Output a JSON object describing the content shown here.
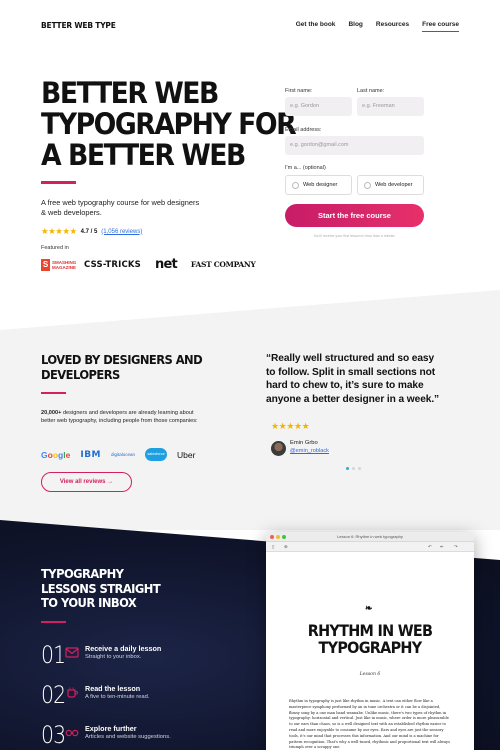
{
  "header": {
    "logo": "BETTER WEB TYPE",
    "nav": [
      "Get the book",
      "Blog",
      "Resources",
      "Free course"
    ],
    "nav_active_index": 3
  },
  "hero": {
    "title_lines": [
      "BETTER WEB",
      "TYPOGRAPHY FOR",
      "A BETTER WEB"
    ],
    "subtitle": "A free web typography course for web designers & web developers.",
    "stars": "★★★★★",
    "rating": "4.7 / 5",
    "rating_count": "(1,056 reviews)",
    "featured_label": "Featured in",
    "press": {
      "smashing": "SMASHING MAGAZINE",
      "css_tricks": "CSS-TRICKS",
      "net": "net",
      "fast_company": "FAST COMPANY"
    }
  },
  "signup": {
    "first_name_label": "First name:",
    "first_name_placeholder": "e.g. Gordon",
    "last_name_label": "Last name:",
    "last_name_placeholder": "e.g. Freeman",
    "email_label": "Email address:",
    "email_placeholder": "e.g. gordon@gmail.com",
    "role_label": "I'm a... (optional)",
    "role_options": [
      "Web designer",
      "Web developer"
    ],
    "submit_label": "Start the free course",
    "fine_print": "You'll receive your first lesson in less than a minute."
  },
  "social_proof": {
    "title_lines": [
      "LOVED BY DESIGNERS AND",
      "DEVELOPERS"
    ],
    "text_strong": "20,000+",
    "text": " designers and developers are already learning about better web typography, including people from those companies:",
    "brands": [
      "Google",
      "IBM",
      "digitalocean",
      "salesforce",
      "Uber"
    ],
    "button_label": "View all reviews →"
  },
  "testimonial": {
    "quote": "“Really well structured and so easy to follow. Split in small sections not hard to chew to, it’s sure to make anyone a better designer in a week.”",
    "stars": "★★★★★",
    "author": "Emin Grbo",
    "handle": "@emin_roblack",
    "slides_total": 3,
    "active_slide": 1
  },
  "lessons": {
    "title_lines": [
      "TYPOGRAPHY",
      "LESSONS STRAIGHT",
      "TO YOUR INBOX"
    ],
    "steps": [
      {
        "num": "01",
        "icon": "envelope-icon",
        "title": "Receive a daily lesson",
        "sub": "Straight to your inbox."
      },
      {
        "num": "02",
        "icon": "coffee-cup-icon",
        "title": "Read the lesson",
        "sub": "A five to ten-minute read."
      },
      {
        "num": "03",
        "icon": "glasses-icon",
        "title": "Explore further",
        "sub": "Articles and website suggestions."
      }
    ]
  },
  "book_window": {
    "window_title": "Lesson 6: Rhythm in web typography",
    "mark": "❧",
    "title_lines": [
      "RHYTHM IN WEB",
      "TYPOGRAPHY"
    ],
    "lesson": "Lesson 6",
    "body": "Rhythm in typography is just like rhythm in music. A text can either flow like a masterpiece symphony performed by an in tune orchestra or it can be a disjointed, flimsy song by a one man band wannabe. Unlike music, there's two types of rhythm in typography: horizontal and vertical. Just like in music, where order is more pleasurable to our ears than chaos, so is a well designed text with an established rhythm easier to read and more enjoyable to consume by our eyes. Ears and eyes are just the sensory tools, it's our mind that processes this information. And our mind is a machine for pattern recognition. That's why a well-tuned, rhythmic and proportional text will always triumph over a scrappy one."
  },
  "colors": {
    "accent": "#d3205e",
    "link": "#2d6cdf",
    "star": "#f5b400",
    "dark_bg": "#10152c"
  }
}
